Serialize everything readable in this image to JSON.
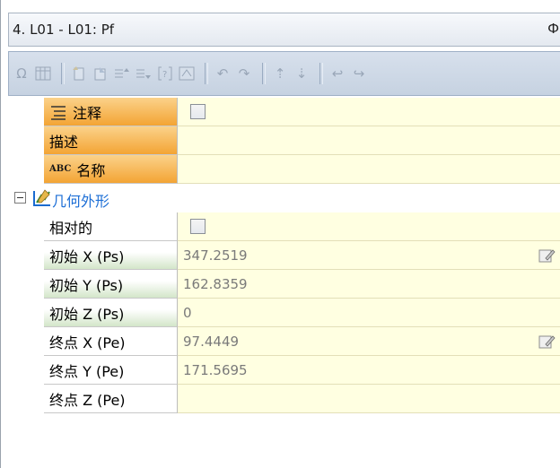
{
  "window": {
    "title": "4. L01 - L01: Pf",
    "pin_glyph": "Ф"
  },
  "toolbar": {
    "icons": [
      "omega-icon",
      "grid-icon",
      "new-icon",
      "paste-icon",
      "indent-up-icon",
      "indent-down-icon",
      "bracket-icon",
      "matrix-icon",
      "rotate-left-icon",
      "rotate-right-icon",
      "step-up-icon",
      "step-down-icon",
      "undo-arc-icon",
      "redo-arc-icon"
    ]
  },
  "properties": {
    "comment": {
      "label": "注释",
      "checked": false
    },
    "description": {
      "label": "描述",
      "value": ""
    },
    "name": {
      "label": "名称",
      "prefix": "ABC",
      "value": ""
    }
  },
  "geometry": {
    "section_label": "几何外形",
    "relative": {
      "label": "相对的",
      "checked": false
    },
    "rows": [
      {
        "label": "初始 X (Ps)",
        "value": "347.2519",
        "lookup": true
      },
      {
        "label": "初始 Y (Ps)",
        "value": "162.8359",
        "lookup": false
      },
      {
        "label": "初始 Z (Ps)",
        "value": "0",
        "lookup": false
      },
      {
        "label": "终点 X (Pe)",
        "value": "97.4449",
        "lookup": true
      },
      {
        "label": "终点 Y (Pe)",
        "value": "171.5695",
        "lookup": false
      },
      {
        "label": "终点 Z (Pe)",
        "value": "",
        "lookup": false
      }
    ]
  },
  "colors": {
    "header_orange": "#f3a434",
    "value_bg": "#ffffe1",
    "section_text": "#1e6fd6",
    "green_label": "#d3e6c9"
  }
}
